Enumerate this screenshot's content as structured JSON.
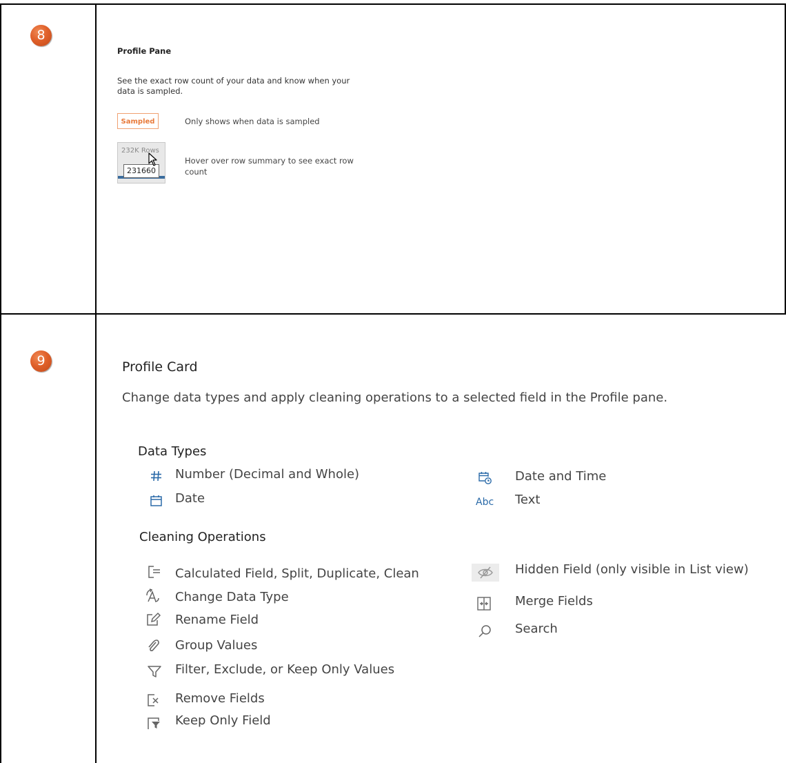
{
  "row8": {
    "badge": "8",
    "title": "Profile Pane",
    "description_line1": "See the exact row count of your data and know when your",
    "description_line2": "data is sampled.",
    "sampled_badge": "Sampled",
    "sampled_note": "Only shows when data is sampled",
    "row_summary_label": "232K Rows",
    "row_exact_count": "231660",
    "hover_note_line1": "Hover over row summary  to see exact row",
    "hover_note_line2": "count"
  },
  "row9": {
    "badge": "9",
    "title": "Profile Card",
    "description": "Change data types and apply cleaning operations to a selected field in the Profile pane.",
    "data_types": {
      "heading": "Data Types",
      "items": [
        {
          "icon": "number-icon",
          "label": "Number (Decimal and Whole)"
        },
        {
          "icon": "date-icon",
          "label": "Date"
        },
        {
          "icon": "date-time-icon",
          "label": "Date and Time"
        },
        {
          "icon": "text-icon",
          "glyph": "Abc",
          "label": "Text"
        }
      ]
    },
    "cleaning": {
      "heading": "Cleaning Operations",
      "items": [
        {
          "icon": "calculated-field-icon",
          "label": "Calculated Field, Split, Duplicate, Clean"
        },
        {
          "icon": "change-data-type-icon",
          "label": "Change Data Type"
        },
        {
          "icon": "rename-field-icon",
          "label": "Rename Field"
        },
        {
          "icon": "group-values-icon",
          "label": "Group Values"
        },
        {
          "icon": "filter-icon",
          "label": "Filter, Exclude, or Keep Only  Values"
        },
        {
          "icon": "remove-fields-icon",
          "label": "Remove Fields"
        },
        {
          "icon": "keep-only-field-icon",
          "label": "Keep Only  Field"
        },
        {
          "icon": "hidden-field-icon",
          "label": "Hidden Field (only visible in List view)"
        },
        {
          "icon": "merge-fields-icon",
          "label": "Merge Fields"
        },
        {
          "icon": "search-icon",
          "label": "Search"
        }
      ]
    }
  },
  "colors": {
    "badge_orange": "#e0602a",
    "sampled_orange": "#e87a3a",
    "icon_blue": "#2a6aa8",
    "icon_gray": "#666666"
  }
}
